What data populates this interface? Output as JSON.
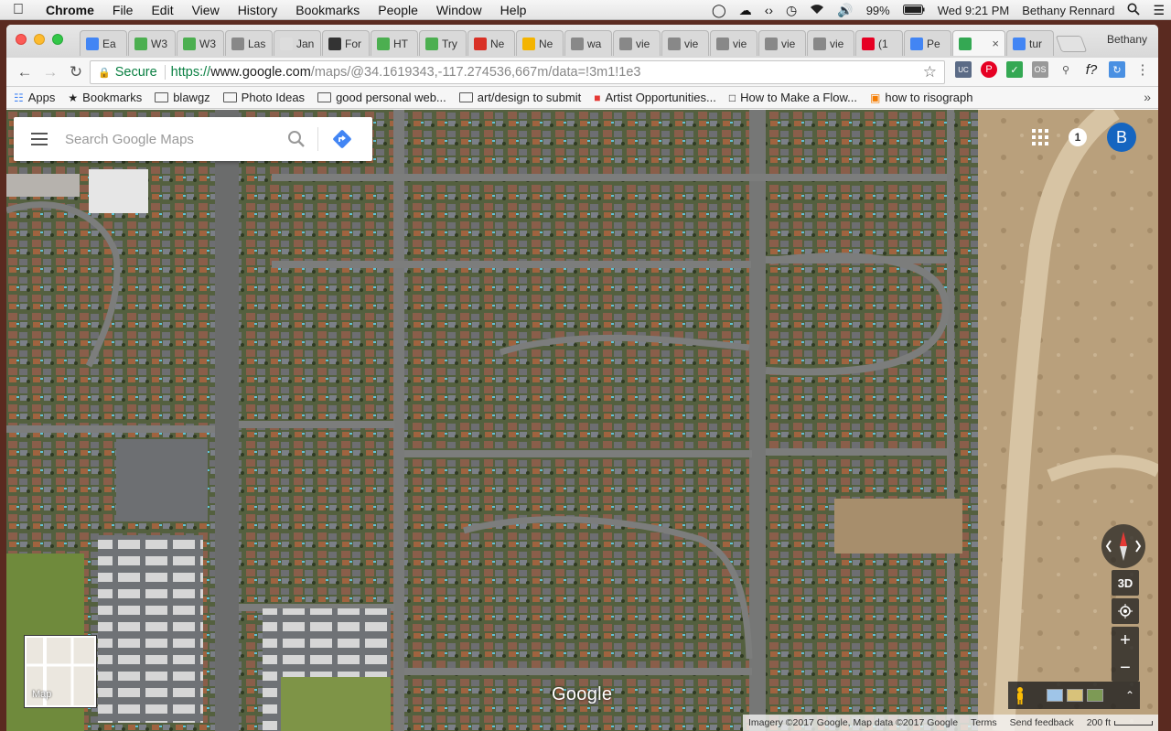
{
  "menubar": {
    "app": "Chrome",
    "items": [
      "File",
      "Edit",
      "View",
      "History",
      "Bookmarks",
      "People",
      "Window",
      "Help"
    ],
    "battery": "99%",
    "clock": "Wed 9:21 PM",
    "user": "Bethany Rennard"
  },
  "tabs": [
    {
      "label": "Ea",
      "icon": "docs-icon",
      "color": "#4285f4"
    },
    {
      "label": "W3",
      "icon": "w3schools-icon",
      "color": "#4caf50"
    },
    {
      "label": "W3",
      "icon": "w3schools-icon",
      "color": "#4caf50"
    },
    {
      "label": "Las",
      "icon": "page-icon",
      "color": "#888888"
    },
    {
      "label": "Jan",
      "icon": "blank-icon",
      "color": "#dddddd"
    },
    {
      "label": "For",
      "icon": "crown-icon",
      "color": "#333333"
    },
    {
      "label": "HT",
      "icon": "w3schools-icon",
      "color": "#4caf50"
    },
    {
      "label": "Try",
      "icon": "w3schools-icon",
      "color": "#4caf50"
    },
    {
      "label": "Ne",
      "icon": "gmail-icon",
      "color": "#d93025"
    },
    {
      "label": "Ne",
      "icon": "slides-icon",
      "color": "#f4b400"
    },
    {
      "label": "wa",
      "icon": "page-icon",
      "color": "#888888"
    },
    {
      "label": "vie",
      "icon": "page-icon",
      "color": "#888888"
    },
    {
      "label": "vie",
      "icon": "page-icon",
      "color": "#888888"
    },
    {
      "label": "vie",
      "icon": "page-icon",
      "color": "#888888"
    },
    {
      "label": "vie",
      "icon": "page-icon",
      "color": "#888888"
    },
    {
      "label": "vie",
      "icon": "page-icon",
      "color": "#888888"
    },
    {
      "label": "(1",
      "icon": "pinterest-icon",
      "color": "#e60023"
    },
    {
      "label": "Pe",
      "icon": "google-icon",
      "color": "#4285f4"
    },
    {
      "label": "",
      "icon": "maps-icon",
      "color": "#34a853",
      "active": true
    },
    {
      "label": "tur",
      "icon": "google-icon",
      "color": "#4285f4"
    }
  ],
  "profile": "Bethany",
  "omnibox": {
    "secure_label": "Secure",
    "url_scheme": "https://",
    "url_host": "www.google.com",
    "url_path": "/maps/@34.1619343,-117.274536,667m/data=!3m1!1e3"
  },
  "bookmarks": [
    {
      "label": "Apps",
      "icon": "apps-icon"
    },
    {
      "label": "Bookmarks",
      "icon": "star-icon"
    },
    {
      "label": "blawgz",
      "icon": "folder-icon"
    },
    {
      "label": "Photo Ideas",
      "icon": "folder-icon"
    },
    {
      "label": "good personal web...",
      "icon": "folder-icon"
    },
    {
      "label": "art/design to submit",
      "icon": "folder-icon"
    },
    {
      "label": "Artist Opportunities...",
      "icon": "red-square-icon"
    },
    {
      "label": "How to Make a Flow...",
      "icon": "page-icon"
    },
    {
      "label": "how to risograph",
      "icon": "cb-icon"
    }
  ],
  "maps": {
    "search_placeholder": "Search Google Maps",
    "notification_count": "1",
    "avatar_letter": "B",
    "minimap_label": "Map",
    "btn_3d": "3D",
    "google_logo": "Google",
    "attribution": "Imagery ©2017 Google, Map data ©2017 Google",
    "terms": "Terms",
    "feedback": "Send feedback",
    "scale": "200 ft"
  },
  "colors": {
    "secure_green": "#0b8043",
    "maps_blue": "#4285f4",
    "avatar_blue": "#1565c0"
  }
}
